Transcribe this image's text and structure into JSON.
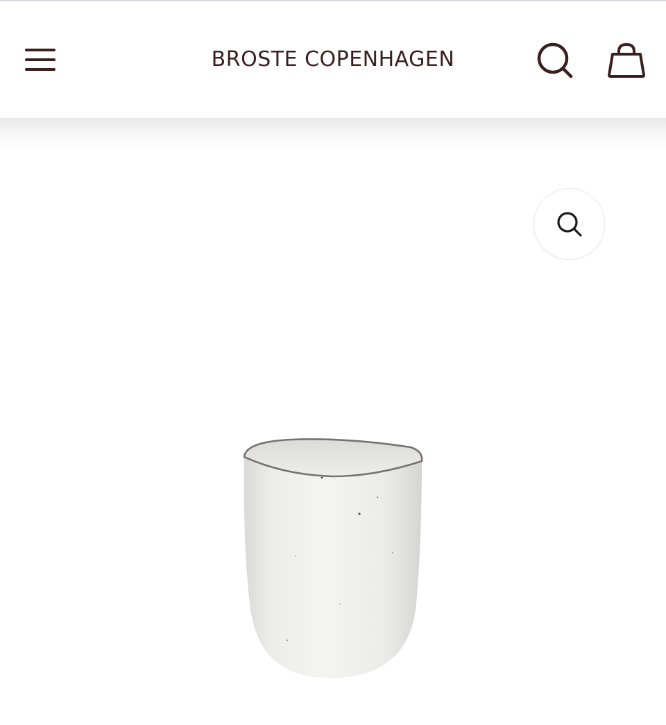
{
  "header": {
    "brand": "BROSTE COPENHAGEN",
    "menu_icon": "hamburger-menu-icon",
    "search_icon": "search-icon",
    "cart_icon": "shopping-bag-icon"
  },
  "gallery": {
    "zoom_icon": "magnifier-zoom-icon",
    "product_image": "speckled-white-ceramic-cup"
  },
  "colors": {
    "brand_text": "#3b1f1f",
    "background": "#ffffff"
  }
}
